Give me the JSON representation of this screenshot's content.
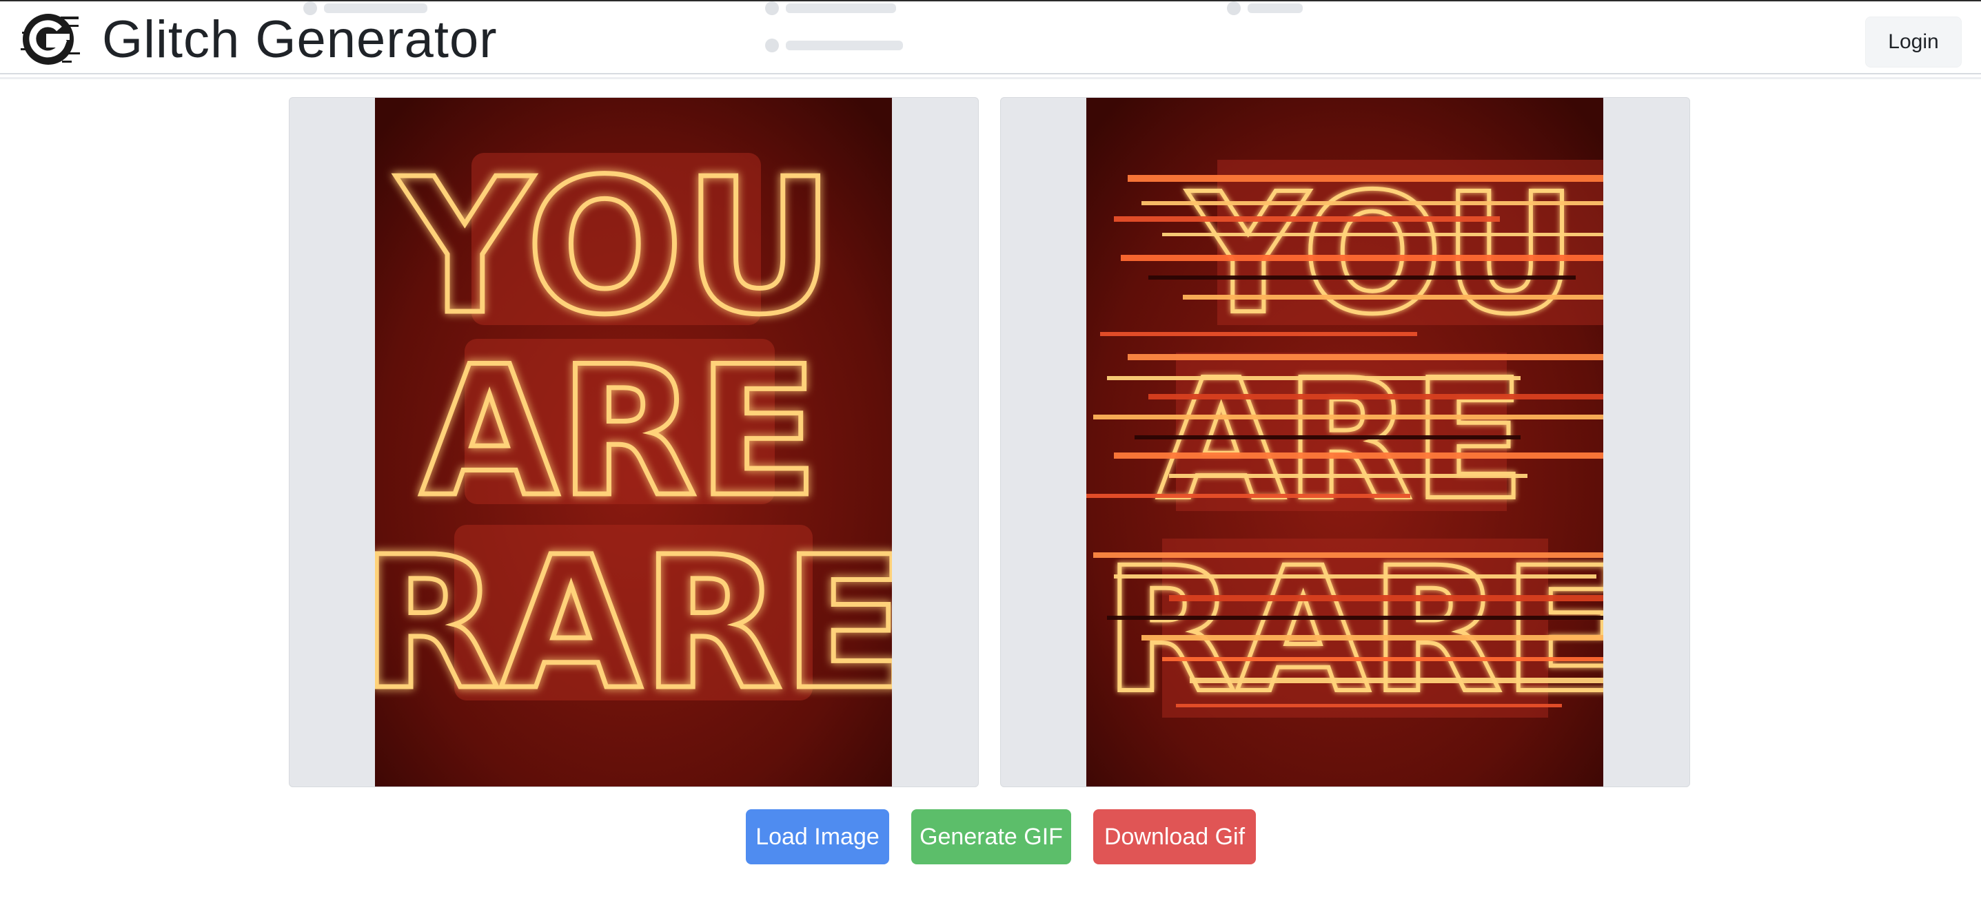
{
  "app": {
    "brand_title": "Glitch Generator",
    "login_label": "Login"
  },
  "left_image": {
    "lines": [
      "YOU",
      "ARE",
      "RARE"
    ]
  },
  "right_image": {
    "lines": [
      "YOU",
      "ARE",
      "RARE"
    ]
  },
  "actions": {
    "load_label": "Load Image",
    "generate_label": "Generate GIF",
    "download_label": "Download Gif"
  },
  "colors": {
    "load": "#4f8cf0",
    "generate": "#5cbe6a",
    "download": "#e05555",
    "neon": "#ffd27a",
    "neon_glow": "#ff5a2a",
    "backdrop": "#6e120b"
  }
}
